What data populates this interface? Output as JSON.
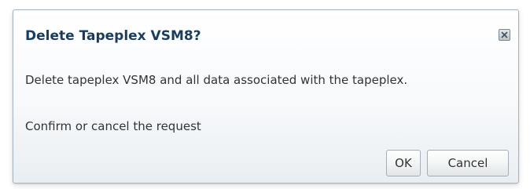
{
  "dialog": {
    "title": "Delete Tapeplex VSM8?",
    "message": "Delete tapeplex VSM8 and all data associated with the tapeplex.",
    "prompt": "Confirm or cancel the request",
    "close_icon": "close-icon",
    "buttons": {
      "ok_label": "OK",
      "cancel_label": "Cancel"
    }
  },
  "colors": {
    "title": "#1a3d5f",
    "body_text": "#333333",
    "border": "#a7b3bd"
  }
}
